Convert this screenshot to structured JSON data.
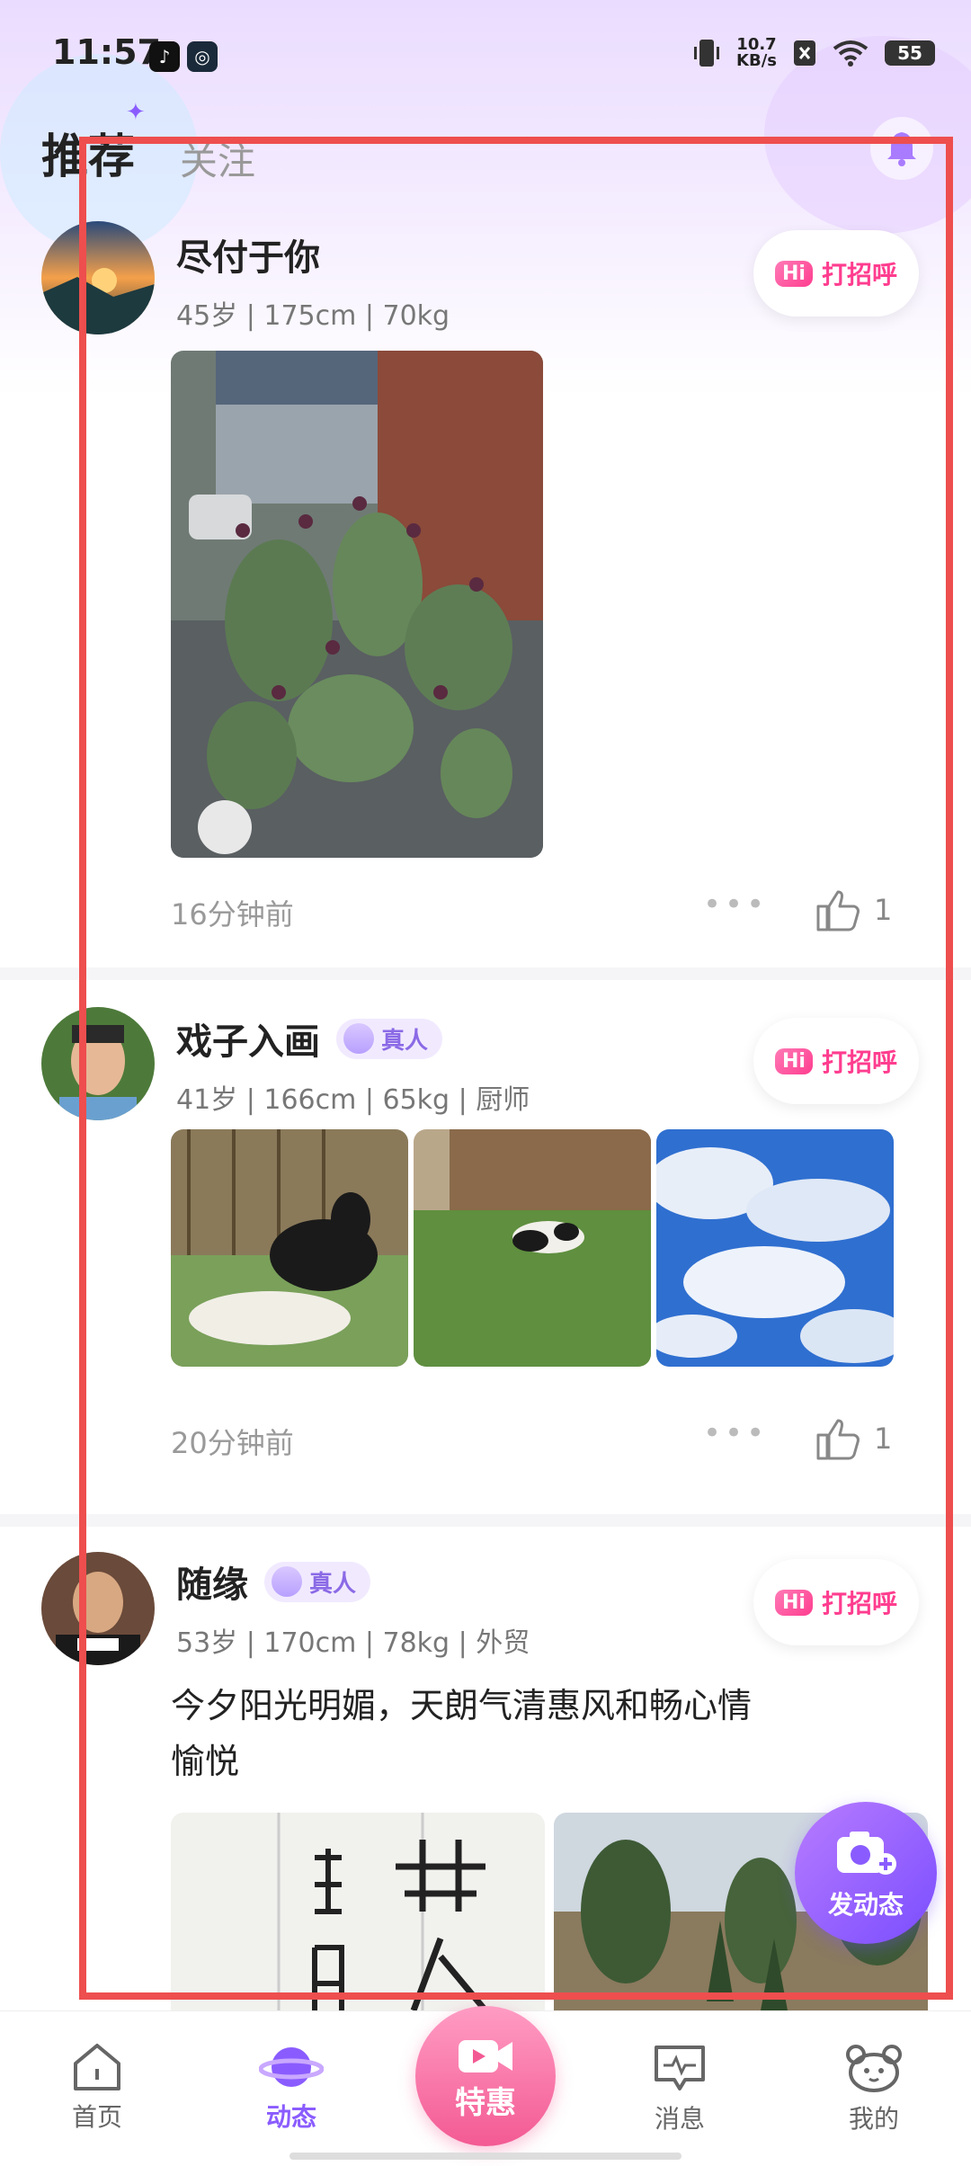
{
  "status_bar": {
    "time": "11:57",
    "net_speed_value": "10.7",
    "net_speed_unit": "KB/s",
    "battery": "55"
  },
  "tabs": {
    "recommend": "推荐",
    "follow": "关注"
  },
  "colors": {
    "accent": "#8a5cff",
    "pink": "#ff3d8f",
    "frame": "#ee4e4e"
  },
  "posts": [
    {
      "name": "尽付于你",
      "meta": "45岁 | 175cm | 70kg",
      "greet_label": "打招呼",
      "greet_chip": "Hi",
      "time_ago": "16分钟前",
      "likes": "1"
    },
    {
      "name": "戏子入画",
      "badge": "真人",
      "meta": "41岁 | 166cm | 65kg | 厨师",
      "greet_label": "打招呼",
      "greet_chip": "Hi",
      "time_ago": "20分钟前",
      "likes": "1"
    },
    {
      "name": "随缘",
      "badge": "真人",
      "meta": "53岁 | 170cm | 78kg | 外贸",
      "greet_label": "打招呼",
      "greet_chip": "Hi",
      "text": "今夕阳光明媚，天朗气清惠风和畅心情愉悦"
    }
  ],
  "fab": {
    "label": "发动态"
  },
  "nav": {
    "home": "首页",
    "moments": "动态",
    "special": "特惠",
    "messages": "消息",
    "mine": "我的"
  }
}
